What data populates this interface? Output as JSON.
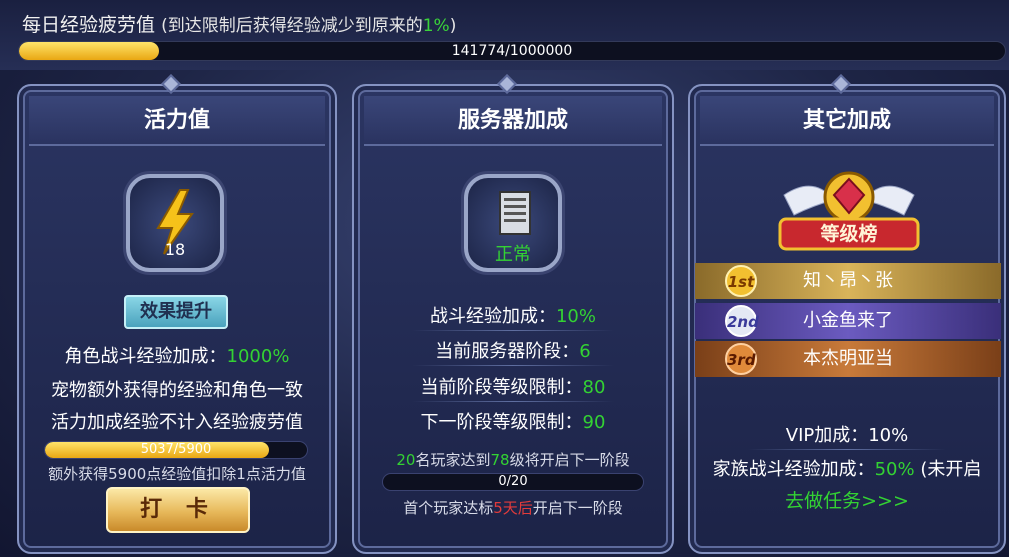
{
  "header": {
    "title": "每日经验疲劳值",
    "note_prefix": "(到达限制后获得经验减少到原来的",
    "note_pct": "1%",
    "note_suffix": ")",
    "progress": {
      "current": 141774,
      "max": 1000000,
      "text": "141774/1000000"
    }
  },
  "vitality": {
    "title": "活力值",
    "icon": "lightning-bolt-icon",
    "value": "18",
    "boost_button": "效果提升",
    "combat_exp_label": "角色战斗经验加成：",
    "combat_exp_value": "1000%",
    "pet_note": "宠物额外获得的经验和角色一致",
    "fatigue_note": "活力加成经验不计入经验疲劳值",
    "bar": {
      "current": 5037,
      "max": 5900,
      "text": "5037/5900"
    },
    "deduct_note": "额外获得5900点经验值扣除1点活力值",
    "punch_button": "打 卡"
  },
  "server": {
    "title": "服务器加成",
    "icon": "server-icon",
    "status": "正常",
    "rows": [
      {
        "label": "战斗经验加成：",
        "value": "10%"
      },
      {
        "label": "当前服务器阶段：",
        "value": "6"
      },
      {
        "label": "当前阶段等级限制：",
        "value": "80"
      },
      {
        "label": "下一阶段等级限制：",
        "value": "90"
      }
    ],
    "goal": {
      "count": "20",
      "text1": "名玩家达到",
      "level": "78",
      "text2": "级将开启下一阶段"
    },
    "bar": {
      "current": 0,
      "max": 20,
      "text": "0/20"
    },
    "first_note": {
      "prefix": "首个玩家达标",
      "days": "5天后",
      "suffix": "开启下一阶段"
    }
  },
  "other": {
    "title": "其它加成",
    "emblem_label": "等级榜",
    "ranking": [
      {
        "medal": "1st",
        "name": "知丶昂丶张"
      },
      {
        "medal": "2nd",
        "name": "小金鱼来了"
      },
      {
        "medal": "3rd",
        "name": "本杰明亚当"
      }
    ],
    "vip_label": "VIP加成：",
    "vip_value": "10%",
    "family_label": "家族战斗经验加成：",
    "family_value": "50%",
    "family_state": "(未开启",
    "task_link": "去做任务>>>"
  },
  "colors": {
    "accent_green": "#33d233",
    "warn_red": "#e23b3b",
    "gold": "#f2c030",
    "rank1": "#b9923a",
    "rank2": "#5b4aa3",
    "rank3": "#b56a2a"
  }
}
